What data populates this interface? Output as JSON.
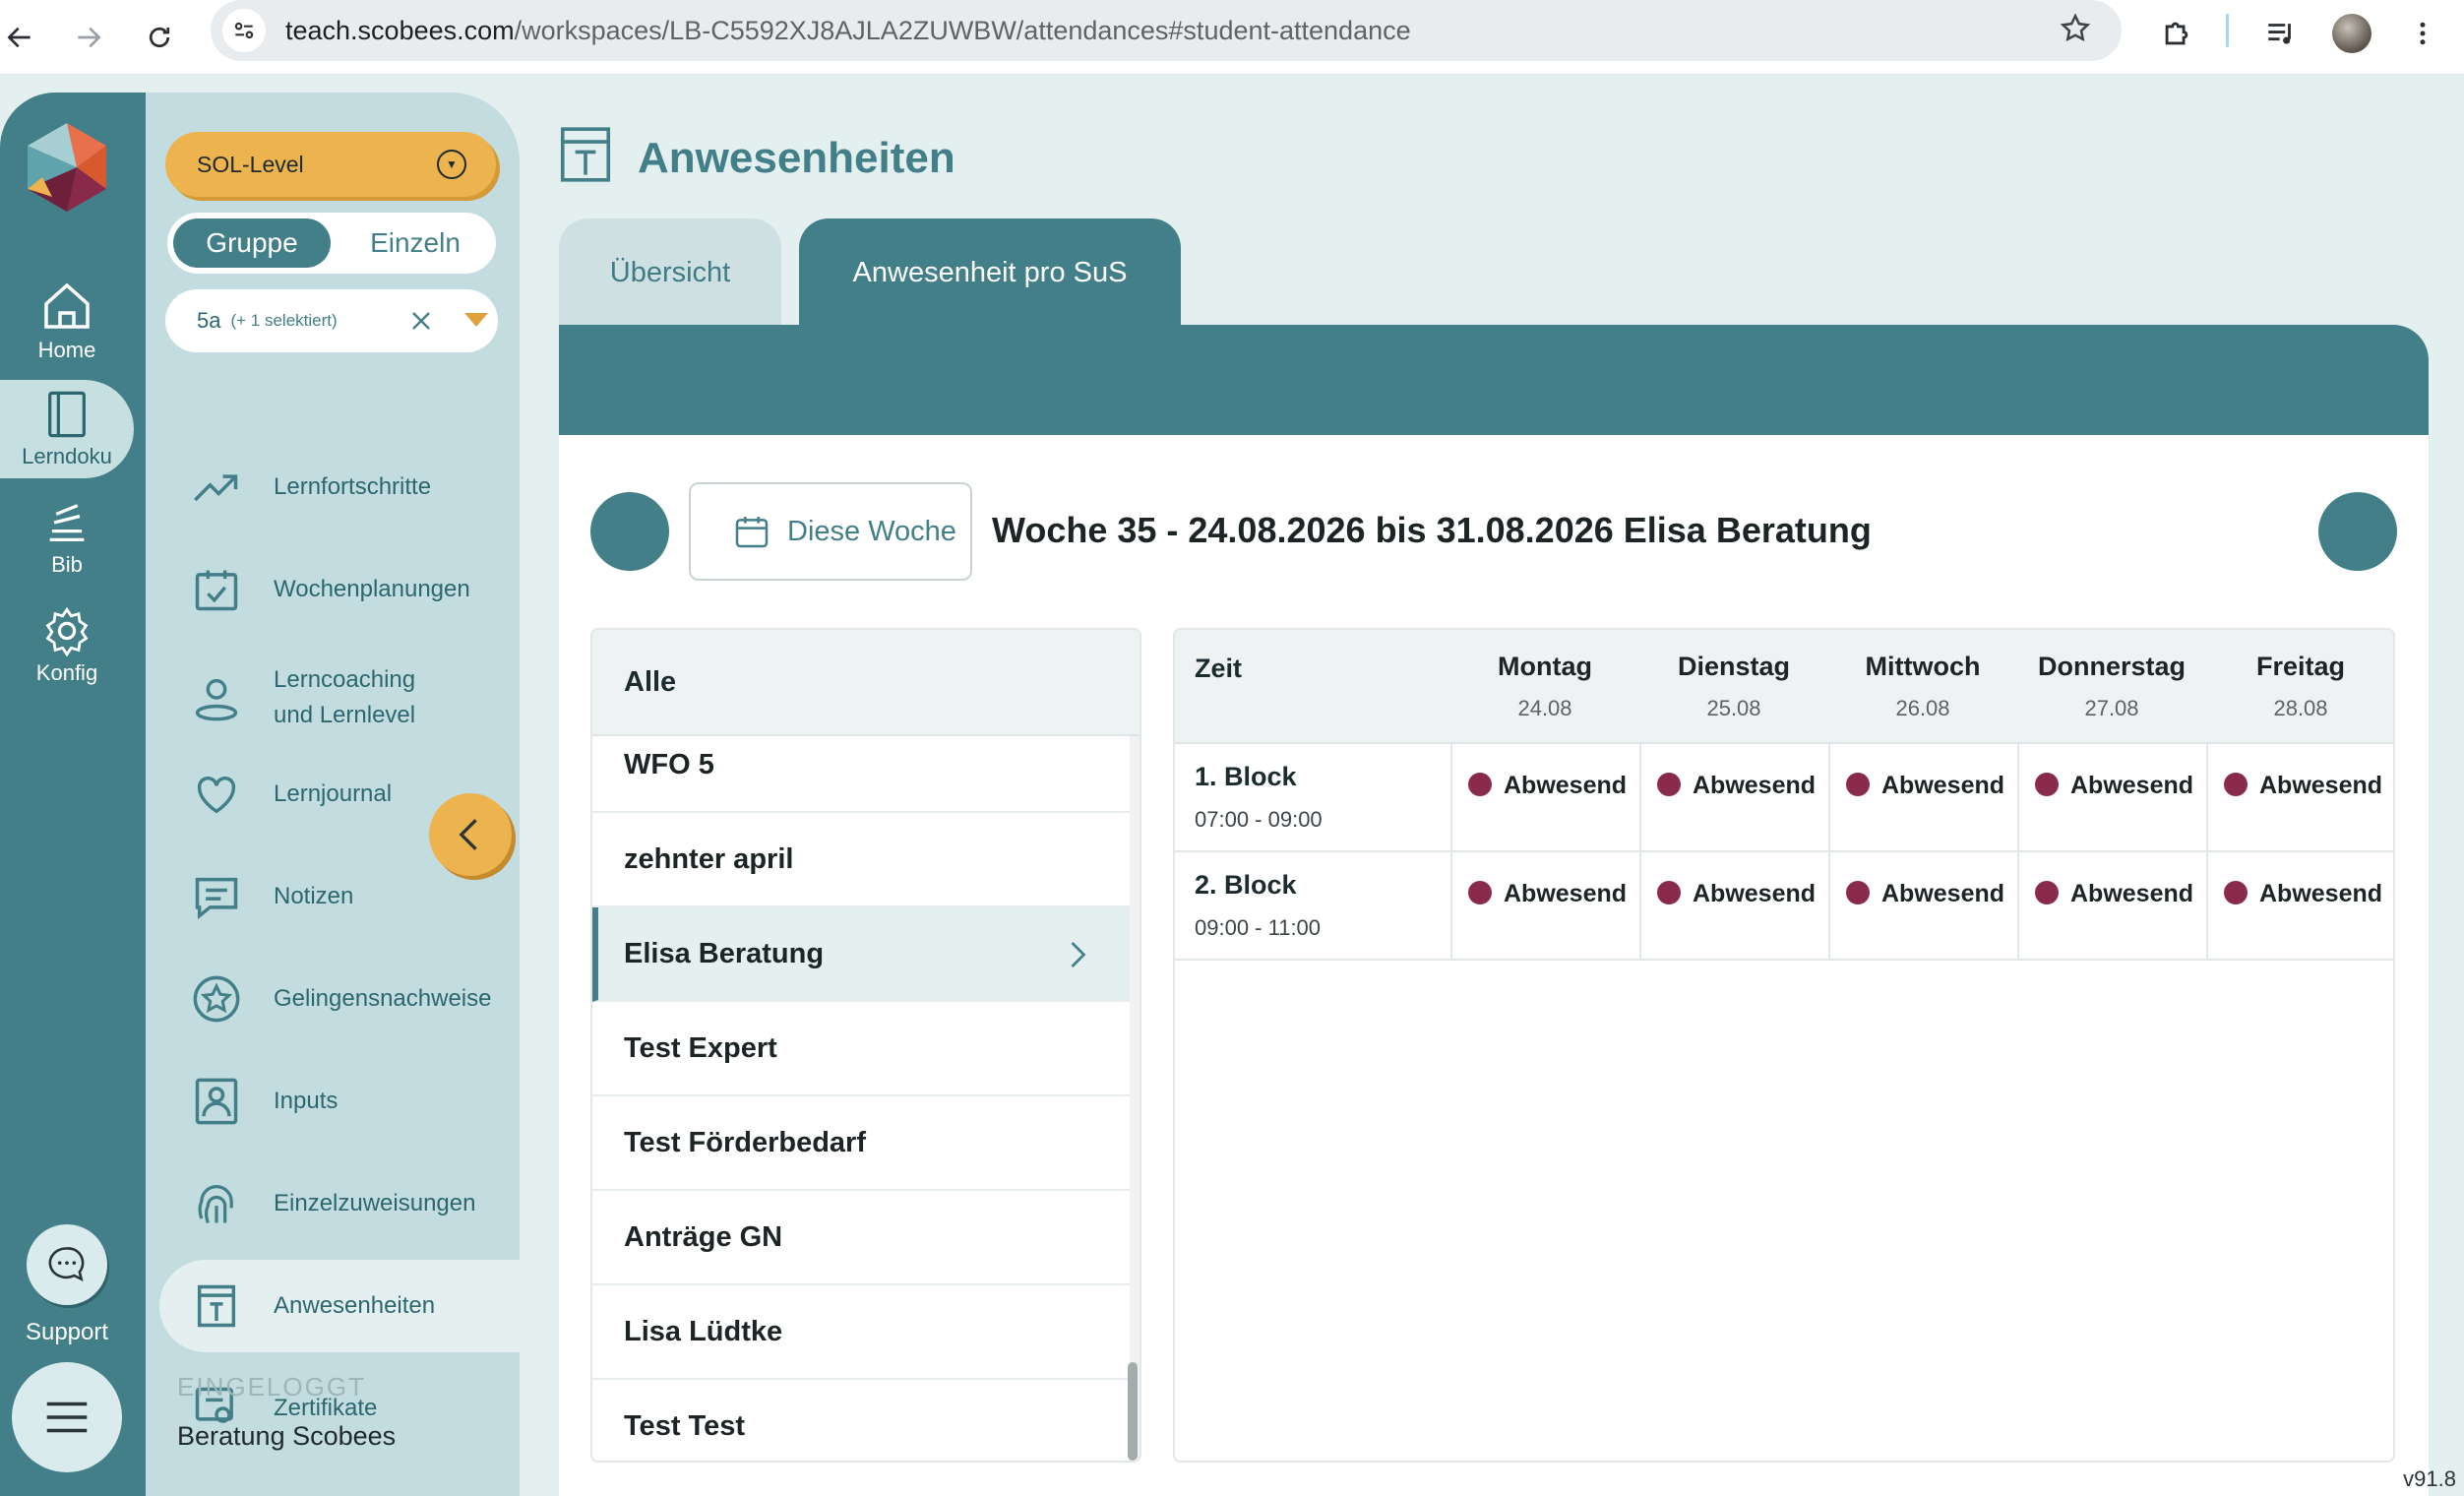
{
  "browser": {
    "url_host": "teach.scobees.com",
    "url_path": "/workspaces/LB-C5592XJ8AJLA2ZUWBW/attendances#student-attendance"
  },
  "rail": {
    "items": [
      {
        "label": "Home",
        "icon": "home-icon"
      },
      {
        "label": "Lerndoku",
        "icon": "book-icon"
      },
      {
        "label": "Bib",
        "icon": "library-icon"
      },
      {
        "label": "Konfig",
        "icon": "gear-icon"
      }
    ],
    "support_label": "Support"
  },
  "side": {
    "level_select": "SOL-Level",
    "toggle": {
      "group": "Gruppe",
      "single": "Einzeln"
    },
    "class_select": {
      "value": "5a",
      "extra": "(+ 1 selektiert)"
    },
    "nav": [
      {
        "label": "Lernfortschritte",
        "icon": "trend-icon"
      },
      {
        "label": "Wochenplanungen",
        "icon": "calendar-check-icon"
      },
      {
        "label": "Lerncoaching\nund Lernlevel",
        "icon": "person-icon"
      },
      {
        "label": "Lernjournal",
        "icon": "heart-icon"
      },
      {
        "label": "Notizen",
        "icon": "note-icon"
      },
      {
        "label": "Gelingensnachweise",
        "icon": "star-badge-icon"
      },
      {
        "label": "Inputs",
        "icon": "portrait-icon"
      },
      {
        "label": "Einzelzuweisungen",
        "icon": "fingerprint-icon"
      },
      {
        "label": "Anwesenheiten",
        "icon": "attendance-icon"
      },
      {
        "label": "Zertifikate",
        "icon": "certificate-icon"
      }
    ],
    "logged_in_label": "EINGELOGGT",
    "user_name": "Beratung Scobees"
  },
  "main": {
    "title": "Anwesenheiten",
    "tabs": [
      {
        "label": "Übersicht",
        "active": false
      },
      {
        "label": "Anwesenheit pro SuS",
        "active": true
      }
    ],
    "this_week_button": "Diese Woche",
    "week_title": "Woche 35 - 24.08.2026 bis 31.08.2026 Elisa Beratung"
  },
  "students": {
    "header": "Alle",
    "items": [
      "WFO 5",
      "zehnter april",
      "Elisa Beratung",
      "Test Expert",
      "Test Förderbedarf",
      "Anträge GN",
      "Lisa Lüdtke",
      "Test Test"
    ],
    "selected": "Elisa Beratung"
  },
  "attendance": {
    "time_header": "Zeit",
    "days": [
      {
        "name": "Montag",
        "date": "24.08"
      },
      {
        "name": "Dienstag",
        "date": "25.08"
      },
      {
        "name": "Mittwoch",
        "date": "26.08"
      },
      {
        "name": "Donnerstag",
        "date": "27.08"
      },
      {
        "name": "Freitag",
        "date": "28.08"
      }
    ],
    "blocks": [
      {
        "name": "1. Block",
        "time": "07:00 - 09:00",
        "status": [
          "Abwesend",
          "Abwesend",
          "Abwesend",
          "Abwesend",
          "Abwesend"
        ]
      },
      {
        "name": "2. Block",
        "time": "09:00 - 11:00",
        "status": [
          "Abwesend",
          "Abwesend",
          "Abwesend",
          "Abwesend",
          "Abwesend"
        ]
      }
    ],
    "absent_color": "#8a2a4a"
  },
  "version": "v91.8",
  "colors": {
    "primary": "#427f88",
    "accent": "#ecb34e"
  }
}
